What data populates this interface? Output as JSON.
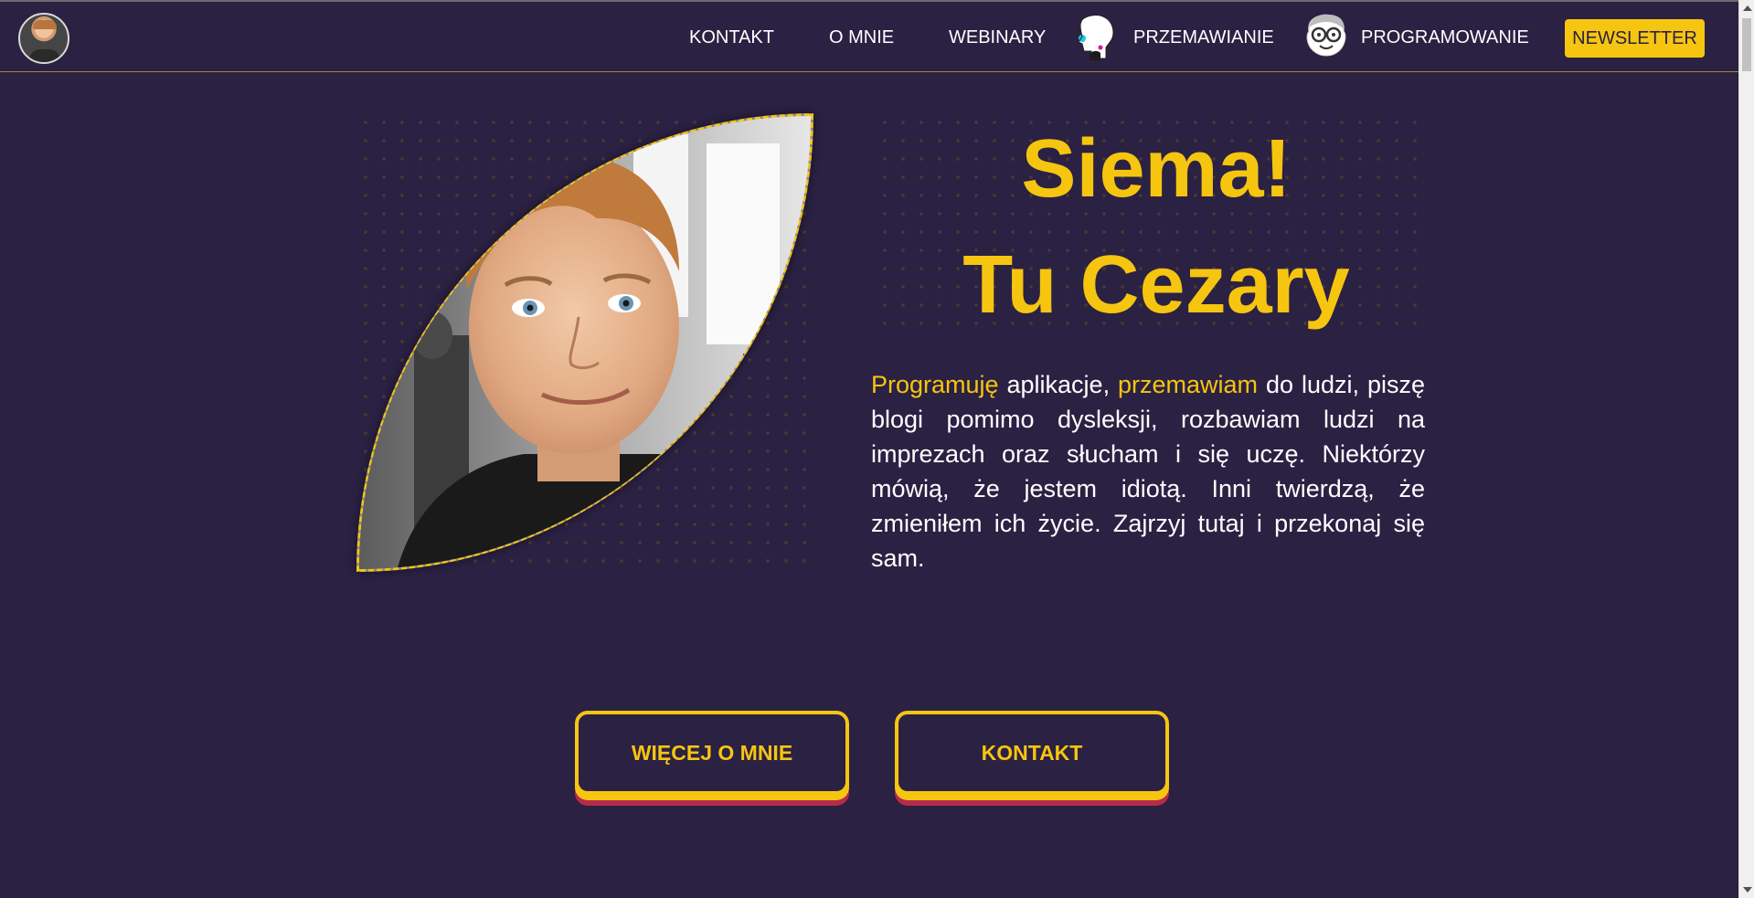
{
  "nav": {
    "items": [
      {
        "label": "KONTAKT"
      },
      {
        "label": "O MNIE"
      },
      {
        "label": "WEBINARY"
      },
      {
        "label": "PRZEMAWIANIE",
        "icon": "speaker-head-icon"
      },
      {
        "label": "PROGRAMOWANIE",
        "icon": "nerd-face-icon"
      }
    ],
    "newsletter": "NEWSLETTER"
  },
  "hero": {
    "greeting_line1": "Siema!",
    "greeting_line2": "Tu Cezary",
    "intro_hl1": "Programuję",
    "intro_t1": " aplikacje, ",
    "intro_hl2": "przemawiam",
    "intro_t2": " do ludzi, piszę blogi pomimo dysleksji, rozbawiam ludzi na imprezach oraz słucham i się uczę. Niektórzy mówią, że jestem idiotą. Inni twierdzą, że zmieniłem ich życie. Zajrzyj tutaj i przekonaj się sam."
  },
  "buttons": {
    "more": "WIĘCEJ O MNIE",
    "contact": "KONTAKT"
  },
  "colors": {
    "background": "#2b2143",
    "accent": "#f6c510",
    "button_shadow": "#b52a4b"
  }
}
